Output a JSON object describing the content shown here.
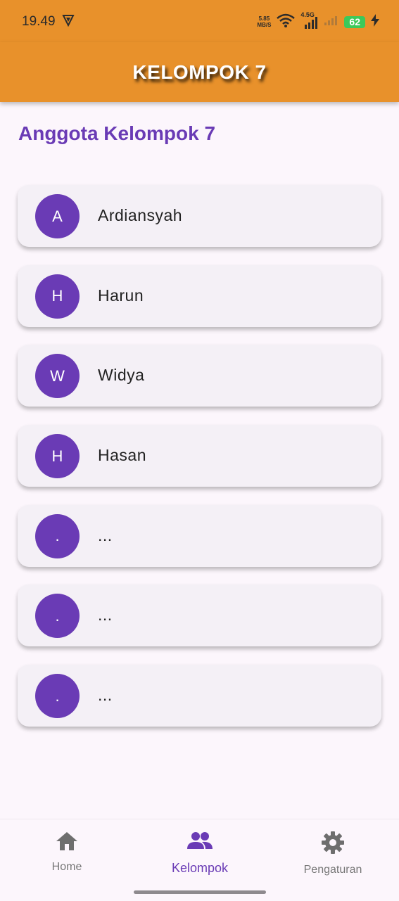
{
  "status_bar": {
    "time": "19.49",
    "net_speed_value": "5.85",
    "net_speed_unit": "MB/S",
    "network_type": "4.5G",
    "battery_level": "62"
  },
  "app_bar": {
    "title": "KELOMPOK 7"
  },
  "section": {
    "title": "Anggota Kelompok 7"
  },
  "members": [
    {
      "initial": "A",
      "name": "Ardiansyah"
    },
    {
      "initial": "H",
      "name": "Harun"
    },
    {
      "initial": "W",
      "name": "Widya"
    },
    {
      "initial": "H",
      "name": "Hasan"
    },
    {
      "initial": ".",
      "name": "..."
    },
    {
      "initial": ".",
      "name": "..."
    },
    {
      "initial": ".",
      "name": "..."
    }
  ],
  "bottom_nav": {
    "items": [
      {
        "label": "Home",
        "icon": "home-icon"
      },
      {
        "label": "Kelompok",
        "icon": "group-icon",
        "active": true
      },
      {
        "label": "Pengaturan",
        "icon": "gear-icon"
      }
    ]
  },
  "colors": {
    "app_bar": "#E8912B",
    "accent": "#6A3BB5",
    "background": "#FCF6FC",
    "card": "#F4F0F6",
    "battery": "#3CC95A"
  }
}
